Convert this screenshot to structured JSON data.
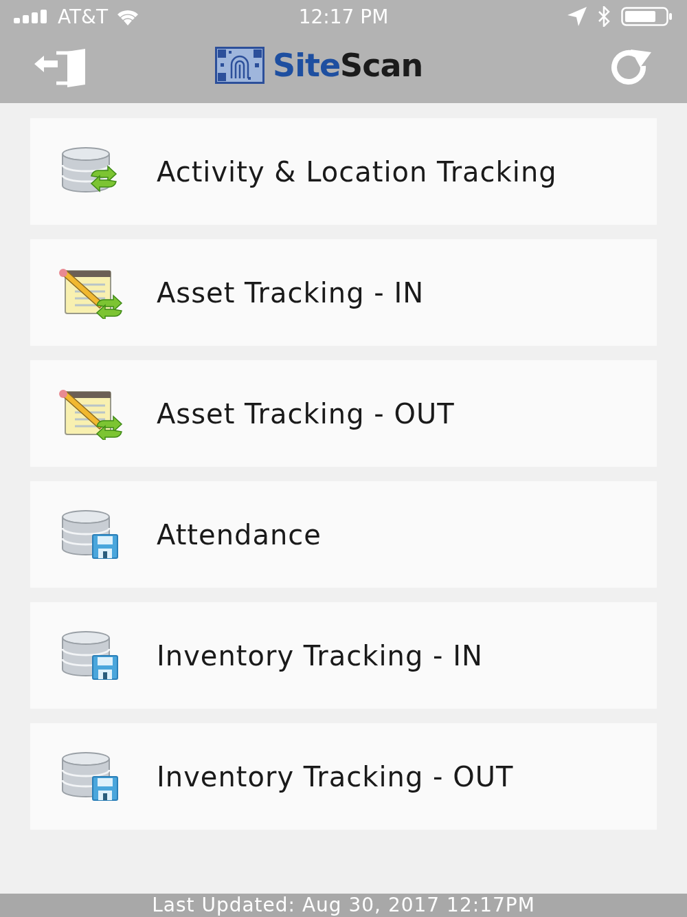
{
  "status_bar": {
    "carrier": "AT&T",
    "time": "12:17 PM"
  },
  "nav_bar": {
    "logo": {
      "part_1": "Site",
      "part_2": "Scan"
    }
  },
  "menu_items": [
    {
      "label": "Activity & Location Tracking",
      "kind": "database-sync"
    },
    {
      "label": "Asset Tracking - IN",
      "kind": "notepad-sync"
    },
    {
      "label": "Asset Tracking - OUT",
      "kind": "notepad-sync"
    },
    {
      "label": "Attendance",
      "kind": "database-save"
    },
    {
      "label": "Inventory Tracking - IN",
      "kind": "database-save"
    },
    {
      "label": "Inventory Tracking - OUT",
      "kind": "database-save"
    }
  ],
  "footer": {
    "text": "Last Updated: Aug 30, 2017 12:17PM"
  }
}
